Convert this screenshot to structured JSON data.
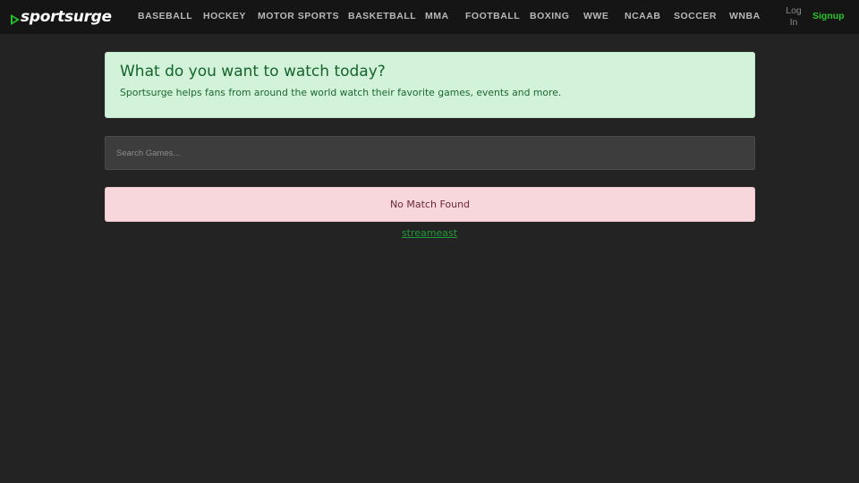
{
  "brand": {
    "name": "sportsurge",
    "icon": "play-triangle-icon",
    "accent": "#27c127"
  },
  "nav": {
    "items": [
      {
        "label": "BASEBALL"
      },
      {
        "label": "HOCKEY"
      },
      {
        "label": "MOTOR SPORTS"
      },
      {
        "label": "BASKETBALL"
      },
      {
        "label": "MMA"
      },
      {
        "label": "FOOTBALL"
      },
      {
        "label": "BOXING"
      },
      {
        "label": "WWE"
      },
      {
        "label": "NCAAB"
      },
      {
        "label": "SOCCER"
      },
      {
        "label": "WNBA"
      }
    ],
    "login_label": "Log In",
    "signup_label": "Signup"
  },
  "hero": {
    "title": "What do you want to watch today?",
    "subtitle": "Sportsurge helps fans from around the world watch their favorite games, events and more."
  },
  "search": {
    "placeholder": "Search Games...",
    "value": ""
  },
  "alert": {
    "text": "No Match Found"
  },
  "footer": {
    "link_label": "streameast"
  },
  "colors": {
    "page_bg": "#232323",
    "navbar_bg": "#151515",
    "hero_bg": "#d3f2da",
    "hero_text": "#14642b",
    "alert_bg": "#f8d7dc",
    "alert_text": "#6d2a33",
    "link": "#1f9a3b"
  }
}
